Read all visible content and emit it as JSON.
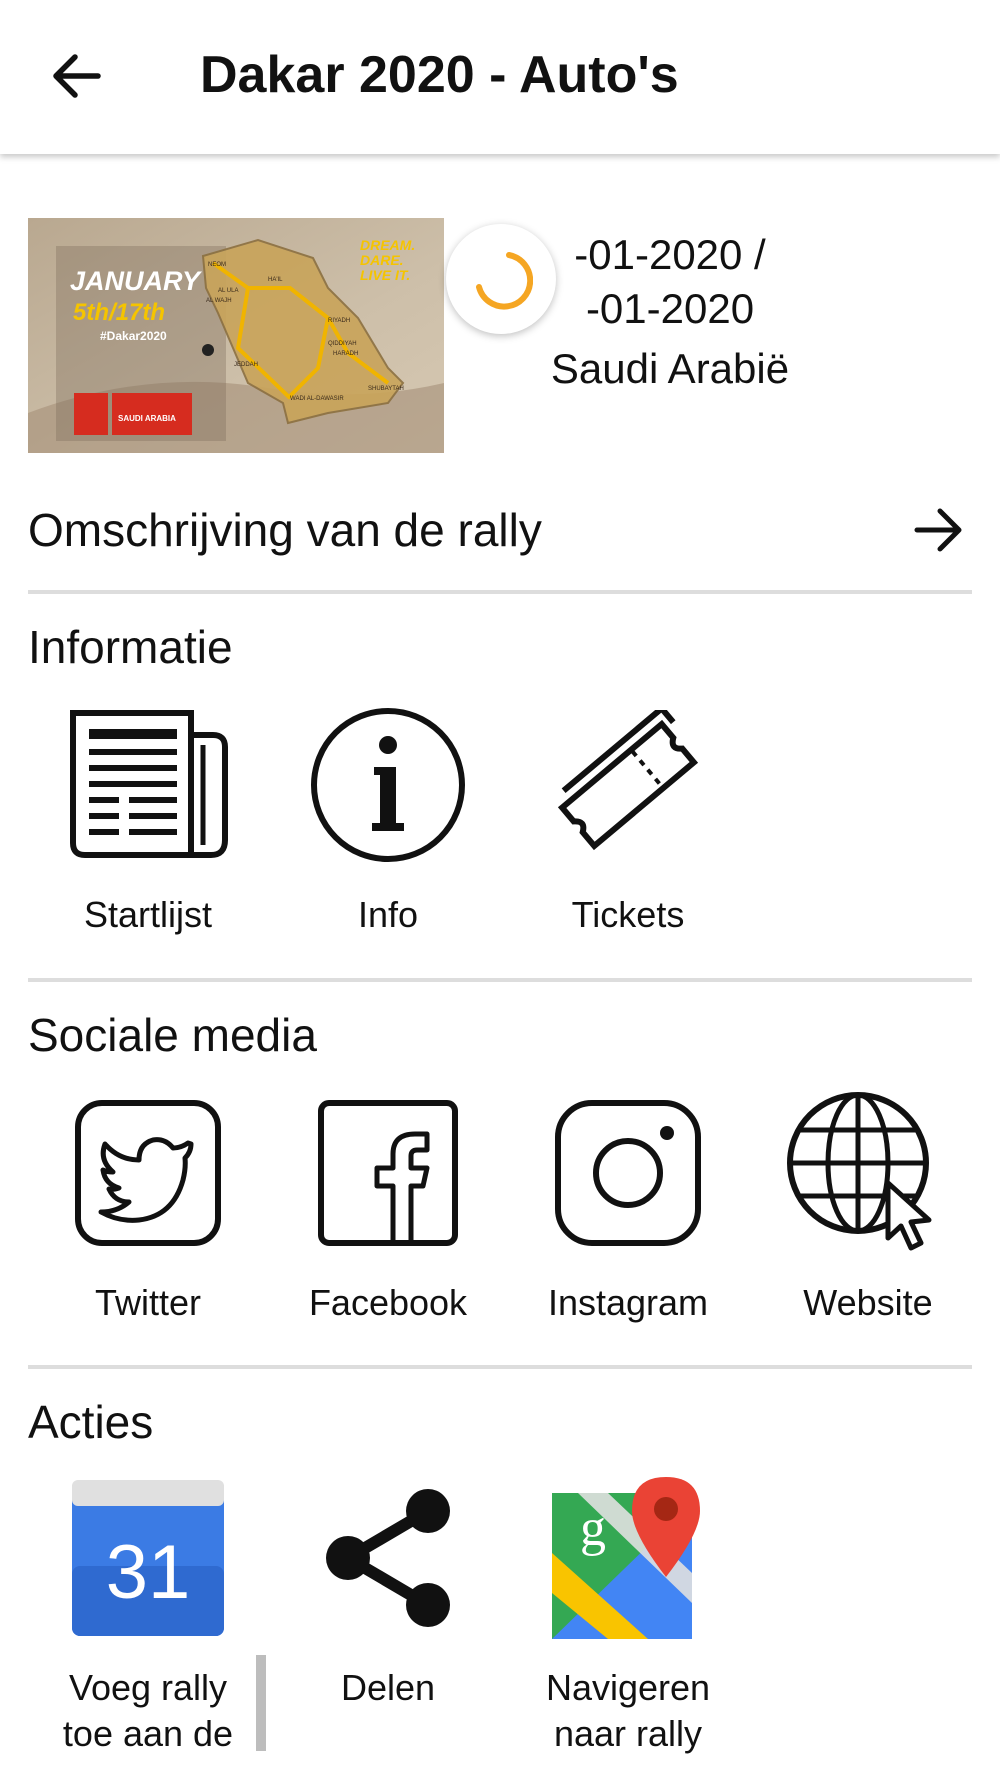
{
  "app_bar": {
    "title": "Dakar 2020 - Auto's",
    "back_icon": "arrow-left-icon"
  },
  "hero_image": {
    "month": "JANUARY",
    "dates": "5th/17th",
    "hashtag": "#Dakar2020",
    "slogan": [
      "DREAM.",
      "DARE.",
      "LIVE IT."
    ],
    "country_badge": "SAUDI ARABIA",
    "cities": [
      "NEOM",
      "HA'IL",
      "AL ULA",
      "AL WAJH",
      "RIYADH",
      "QIDDIYAH",
      "HARADH",
      "JEDDAH",
      "SHUBAYTAH",
      "WADI AL-DAWASIR"
    ]
  },
  "rally_info": {
    "start_date": "-01-2020  /",
    "end_date": "-01-2020",
    "country": "Saudi Arabië"
  },
  "description_link": {
    "label": "Omschrijving van de rally",
    "icon": "arrow-right-icon"
  },
  "sections": {
    "informatie": {
      "title": "Informatie",
      "items": [
        {
          "label": "Startlijst",
          "icon": "newspaper-icon"
        },
        {
          "label": "Info",
          "icon": "info-icon"
        },
        {
          "label": "Tickets",
          "icon": "ticket-icon"
        }
      ]
    },
    "sociale_media": {
      "title": "Sociale media",
      "items": [
        {
          "label": "Twitter",
          "icon": "twitter-icon"
        },
        {
          "label": "Facebook",
          "icon": "facebook-icon"
        },
        {
          "label": "Instagram",
          "icon": "instagram-icon"
        },
        {
          "label": "Website",
          "icon": "globe-cursor-icon"
        }
      ]
    },
    "acties": {
      "title": "Acties",
      "items": [
        {
          "label": "Voeg rally toe aan de",
          "icon": "calendar-icon",
          "calendar_day": "31"
        },
        {
          "label": "Delen",
          "icon": "share-icon"
        },
        {
          "label": "Navigeren naar rally",
          "icon": "maps-icon",
          "maps_letter": "g"
        }
      ]
    }
  },
  "colors": {
    "spinner": "#f5a623",
    "calendar_blue": "#3b7be4",
    "maps_green": "#34a853",
    "maps_red": "#ea4335"
  }
}
